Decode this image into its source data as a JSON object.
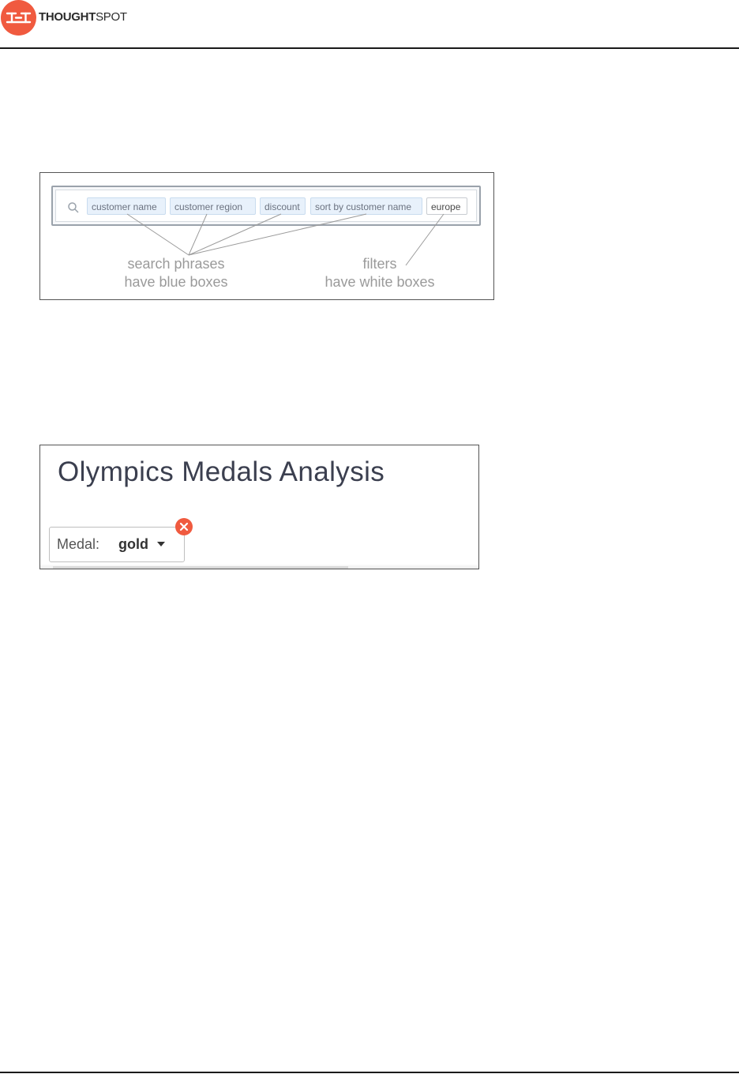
{
  "brand": {
    "logo_bold": "THOUGHT",
    "logo_light": "SPOT",
    "accent_color": "#f05a3f"
  },
  "figure1": {
    "search_icon": "search-icon",
    "tokens": [
      {
        "label": "customer name",
        "kind": "search-phrase"
      },
      {
        "label": "customer region",
        "kind": "search-phrase"
      },
      {
        "label": "discount",
        "kind": "search-phrase"
      },
      {
        "label": "sort by customer name",
        "kind": "search-phrase"
      },
      {
        "label": "europe",
        "kind": "filter"
      }
    ],
    "caption_phrases_line1": "search phrases",
    "caption_phrases_line2": "have blue boxes",
    "caption_filters_line1": "filters",
    "caption_filters_line2": "have white boxes",
    "phrase_box_color": "#e8f1fb",
    "filter_box_color": "#ffffff"
  },
  "figure2": {
    "title": "Olympics Medals Analysis",
    "filter_chip": {
      "label": "Medal:",
      "value": "gold",
      "dropdown_icon": "chevron-down-icon",
      "remove_icon": "close-icon"
    }
  }
}
